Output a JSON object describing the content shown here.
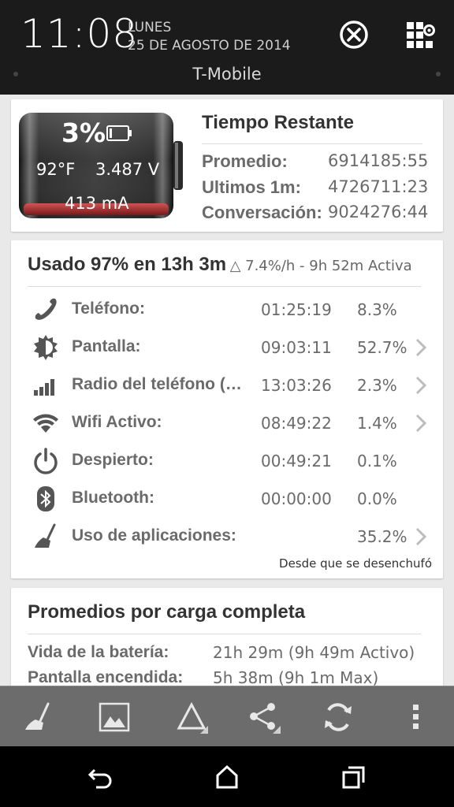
{
  "status": {
    "time": "11:08",
    "day": "LUNES",
    "date": "25 DE AGOSTO DE 2014",
    "carrier": "T-Mobile"
  },
  "battery": {
    "percent": "3%",
    "temperature": "92°F",
    "voltage": "3.487 V",
    "current": "413 mA",
    "level": 0.03
  },
  "remaining": {
    "title": "Tiempo Restante",
    "rows": [
      {
        "label": "Promedio:",
        "value": "6914185:55"
      },
      {
        "label": "Ultimos 1m:",
        "value": "4726711:23"
      },
      {
        "label": "Conversación:",
        "value": "9024276:44"
      }
    ]
  },
  "usage": {
    "headline": "Usado 97% en 13h 3m",
    "detail": "△ 7.4%/h - 9h 52m Activa",
    "rows": [
      {
        "icon": "phone-icon",
        "label": "Teléfono:",
        "time": "01:25:19",
        "percent": "8.3%",
        "chevron": false
      },
      {
        "icon": "brightness-icon",
        "label": "Pantalla:",
        "time": "09:03:11",
        "percent": "52.7%",
        "chevron": true
      },
      {
        "icon": "signal-icon",
        "label": "Radio del teléfono (…",
        "time": "13:03:26",
        "percent": "2.3%",
        "chevron": true
      },
      {
        "icon": "wifi-icon",
        "label": "Wifi Activo:",
        "time": "08:49:22",
        "percent": "1.4%",
        "chevron": true
      },
      {
        "icon": "power-icon",
        "label": "Despierto:",
        "time": "00:49:21",
        "percent": "0.1%",
        "chevron": false
      },
      {
        "icon": "bluetooth-icon",
        "label": "Bluetooth:",
        "time": "00:00:00",
        "percent": "0.0%",
        "chevron": false
      },
      {
        "icon": "broom-icon",
        "label": "Uso de aplicaciones:",
        "time": "",
        "percent": "35.2%",
        "chevron": true
      }
    ],
    "footnote": "Desde que se desenchufó"
  },
  "averages": {
    "title": "Promedios por carga completa",
    "rows": [
      {
        "label": "Vida de la batería:",
        "value": "21h 29m (9h 49m Activo)"
      },
      {
        "label": "Pantalla encendida:",
        "value": "5h 38m (9h 1m Max)"
      }
    ]
  },
  "toolbar": {
    "icons": [
      "broom-icon",
      "image-icon",
      "delta-icon",
      "share-icon",
      "refresh-icon",
      "overflow-menu-icon"
    ]
  },
  "navbar": {
    "icons": [
      "back-icon",
      "home-icon",
      "recents-icon"
    ]
  },
  "colors": {
    "header_bg": "#1b1b1b",
    "page_bg": "#e9e9e9",
    "card_bg": "#ffffff",
    "toolbar_bg": "#6c6c6c",
    "battery_fill": "#d23a3a"
  }
}
